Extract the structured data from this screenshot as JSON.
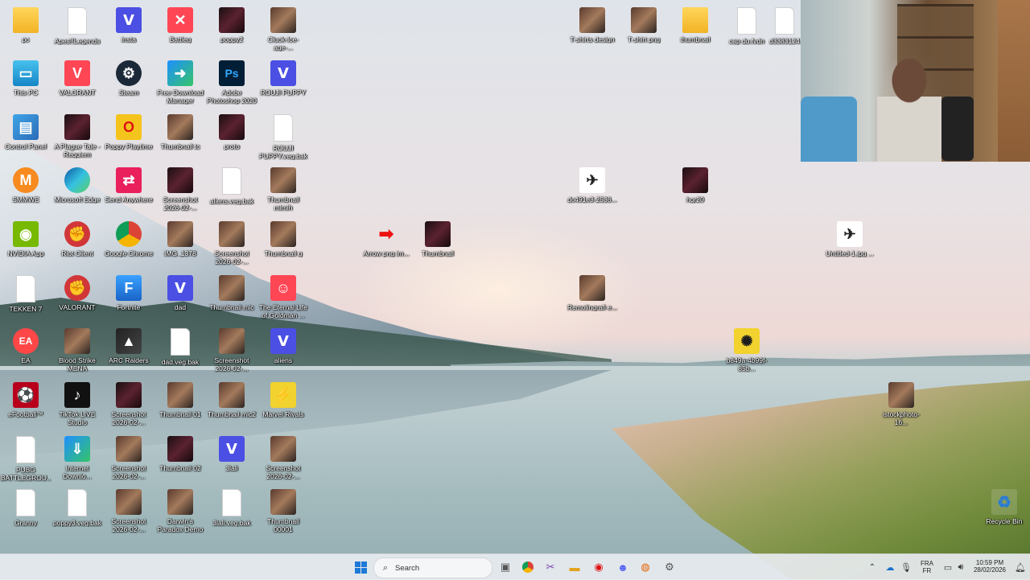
{
  "desktop_icons": [
    {
      "label": "pc",
      "icon": "folder"
    },
    {
      "label": "Apes!!Legends",
      "icon": "file"
    },
    {
      "label": "insta",
      "icon": "v-app"
    },
    {
      "label": "Battleg",
      "icon": "app"
    },
    {
      "label": "poppy2",
      "icon": "photo"
    },
    {
      "label": "Cluck-Ice-age-...",
      "icon": "photo"
    },
    {
      "label": "This PC",
      "icon": "pc"
    },
    {
      "label": "VALORANT",
      "icon": "valorant"
    },
    {
      "label": "Steam",
      "icon": "steam"
    },
    {
      "label": "Free Download Manager",
      "icon": "fdm"
    },
    {
      "label": "Adobe Photoshop 2020",
      "icon": "photoshop"
    },
    {
      "label": "ROUJI PUPPY",
      "icon": "v-app"
    },
    {
      "label": "Control Panel",
      "icon": "control-panel"
    },
    {
      "label": "A Plague Tale - Requiem",
      "icon": "game"
    },
    {
      "label": "Poppy Playtime",
      "icon": "poppy"
    },
    {
      "label": "Thumbnail tc",
      "icon": "photo"
    },
    {
      "label": "proto",
      "icon": "dark"
    },
    {
      "label": "ROUJI PUPPY.veg.bak",
      "icon": "file"
    },
    {
      "label": "SMMWE",
      "icon": "smm"
    },
    {
      "label": "Microsoft Edge",
      "icon": "edge"
    },
    {
      "label": "Send Anywhere",
      "icon": "send"
    },
    {
      "label": "Screenshot 2026-02-...",
      "icon": "dark"
    },
    {
      "label": "aliens.veg.bak",
      "icon": "file"
    },
    {
      "label": "Thumbnail mimih",
      "icon": "photo"
    },
    {
      "label": "NVIDIA App",
      "icon": "nvidia"
    },
    {
      "label": "Riot Client",
      "icon": "riot"
    },
    {
      "label": "Google Chrome",
      "icon": "chrome"
    },
    {
      "label": "IMG_1378",
      "icon": "photo"
    },
    {
      "label": "Screenshot 2026-02-...",
      "icon": "photo"
    },
    {
      "label": "Thumbnail g",
      "icon": "photo"
    },
    {
      "label": "Arrow png im...",
      "icon": "arrow"
    },
    {
      "label": "Thumbnail",
      "icon": "photo"
    },
    {
      "label": "TEKKEN 7",
      "icon": "file"
    },
    {
      "label": "VALORANT",
      "icon": "riot"
    },
    {
      "label": "Fortnite",
      "icon": "fortnite"
    },
    {
      "label": "dad",
      "icon": "v-app"
    },
    {
      "label": "Thumbnail mic",
      "icon": "photo"
    },
    {
      "label": "The Eternal Life of Goldman ...",
      "icon": "game"
    },
    {
      "label": "EA",
      "icon": "ea"
    },
    {
      "label": "Blood Strike MENA",
      "icon": "game"
    },
    {
      "label": "ARC Raiders",
      "icon": "arc"
    },
    {
      "label": "dad.veg.bak",
      "icon": "file"
    },
    {
      "label": "Screenshot 2026-02-...",
      "icon": "photo"
    },
    {
      "label": "aliens",
      "icon": "v-app"
    },
    {
      "label": "eFootball™",
      "icon": "efootball"
    },
    {
      "label": "TikTok LIVE Studio",
      "icon": "tiktok"
    },
    {
      "label": "Screenshot 2026-02-...",
      "icon": "dark"
    },
    {
      "label": "Thumbnail 01",
      "icon": "photo"
    },
    {
      "label": "Thumbnail mic2",
      "icon": "photo"
    },
    {
      "label": "Marvel Rivals",
      "icon": "marvel"
    },
    {
      "label": "PUBG BATTLEGROU...",
      "icon": "file"
    },
    {
      "label": "Internet Downlo...",
      "icon": "idm"
    },
    {
      "label": "Screenshot 2026-02-...",
      "icon": "photo"
    },
    {
      "label": "Thumbnail 02",
      "icon": "photo"
    },
    {
      "label": "3lali",
      "icon": "v-app"
    },
    {
      "label": "Screenshot 2026-02-...",
      "icon": "photo"
    },
    {
      "label": "Granny",
      "icon": "file"
    },
    {
      "label": "poppy3.veg.bak",
      "icon": "file"
    },
    {
      "label": "Screenshot 2026-02-...",
      "icon": "photo"
    },
    {
      "label": "Darwin's Paradox Demo",
      "icon": "game"
    },
    {
      "label": "3lali.veg.bak",
      "icon": "file"
    },
    {
      "label": "Thumbnail 00001",
      "icon": "photo"
    },
    {
      "label": "T-shirts design",
      "icon": "photo"
    },
    {
      "label": "T-shirt png",
      "icon": "photo"
    },
    {
      "label": "thumbnail",
      "icon": "folder"
    },
    {
      "label": "cap du.fvdn",
      "icon": "file"
    },
    {
      "label": "d3383124...",
      "icon": "file"
    },
    {
      "label": "dc491e3-2536...",
      "icon": "photo"
    },
    {
      "label": "hqr20",
      "icon": "photo"
    },
    {
      "label": "Untitled-1.jpg ...",
      "icon": "photo"
    },
    {
      "label": "Remolingrafi e...",
      "icon": "photo"
    },
    {
      "label": "b849a-4b99f-85b...",
      "icon": "photo"
    },
    {
      "label": "istockphoto-16...",
      "icon": "photo"
    },
    {
      "label": "Recycle Bin",
      "icon": "recycle-bin"
    }
  ],
  "taskbar": {
    "search_placeholder": "Search",
    "language": "FRA",
    "keyboard": "FR",
    "time": "10:59 PM",
    "date": "28/02/2026"
  }
}
